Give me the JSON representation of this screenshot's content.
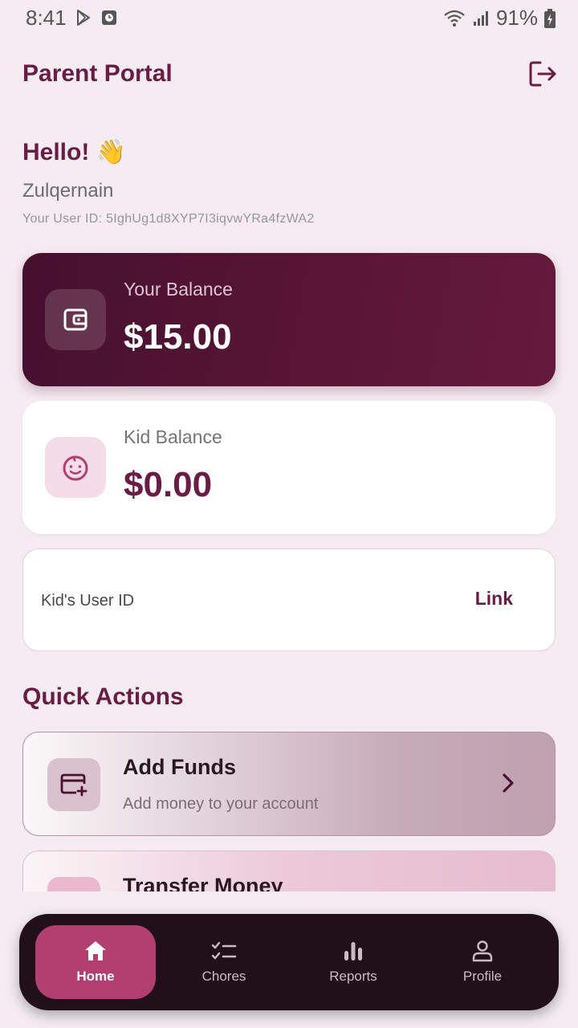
{
  "status_bar": {
    "time": "8:41",
    "battery": "91%"
  },
  "header": {
    "title": "Parent Portal",
    "logout_icon": "logout-icon"
  },
  "greeting": {
    "hello": "Hello! 👋",
    "name": "Zulqernain",
    "user_id": "Your User ID: 5IghUg1d8XYP7I3iqvwYRa4fzWA2"
  },
  "your_balance": {
    "label": "Your Balance",
    "value": "$15.00",
    "icon": "wallet-icon"
  },
  "kid_balance": {
    "label": "Kid Balance",
    "value": "$0.00",
    "icon": "baby-face-icon"
  },
  "link_kid": {
    "placeholder": "Kid's User ID",
    "value": "",
    "button": "Link"
  },
  "quick_actions": {
    "title": "Quick Actions",
    "items": [
      {
        "title": "Add Funds",
        "subtitle": "Add money to your account",
        "icon": "add-card-icon"
      },
      {
        "title": "Transfer Money",
        "subtitle": "",
        "icon": "transfer-icon"
      }
    ]
  },
  "bottom_nav": {
    "items": [
      {
        "label": "Home",
        "icon": "home-icon",
        "active": true
      },
      {
        "label": "Chores",
        "icon": "checklist-icon",
        "active": false
      },
      {
        "label": "Reports",
        "icon": "bar-chart-icon",
        "active": false
      },
      {
        "label": "Profile",
        "icon": "person-icon",
        "active": false
      }
    ]
  },
  "colors": {
    "brand": "#6b1c44",
    "card_dark": "#591535",
    "nav_bg": "#211019",
    "nav_active": "#b23f70",
    "background": "#f4ecf1"
  }
}
